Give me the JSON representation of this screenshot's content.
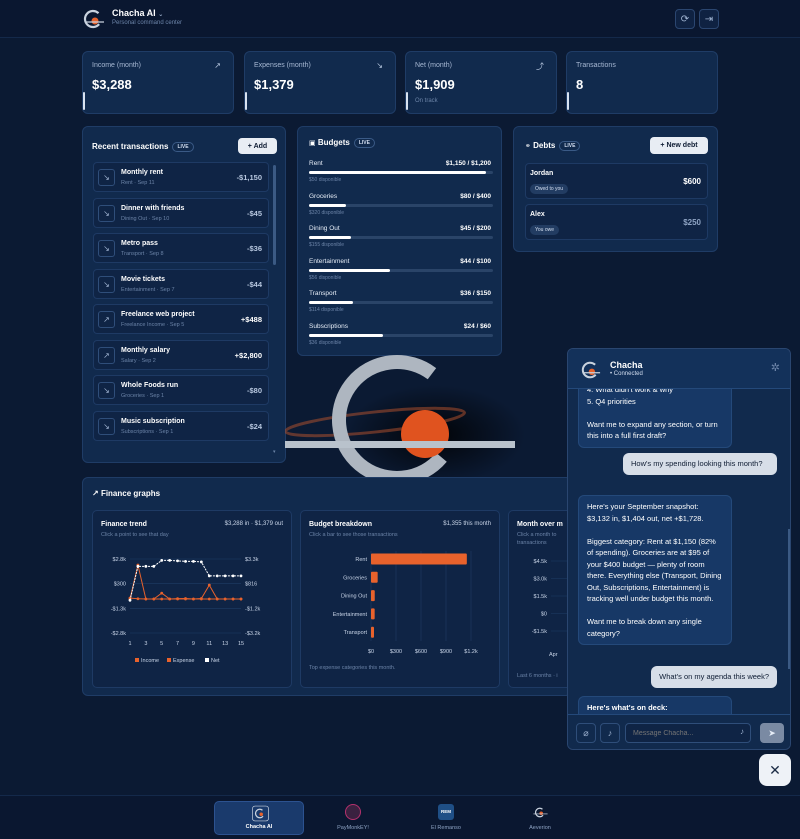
{
  "header": {
    "title": "Chacha AI",
    "subtitle": "Personal command center"
  },
  "stats": [
    {
      "label": "Income (month)",
      "value": "$3,288",
      "sub": "",
      "icon": "arrow-up-right-icon"
    },
    {
      "label": "Expenses (month)",
      "value": "$1,379",
      "sub": "",
      "icon": "arrow-down-right-icon"
    },
    {
      "label": "Net (month)",
      "value": "$1,909",
      "sub": "On track",
      "icon": "trend-up-icon"
    },
    {
      "label": "Transactions",
      "value": "8",
      "sub": "",
      "icon": ""
    }
  ],
  "transactions": {
    "title": "Recent transactions",
    "live": "LIVE",
    "add_label": "+ Add",
    "items": [
      {
        "name": "Monthly rent",
        "sub": "Rent · Sep 11",
        "amount": "-$1,150",
        "dir": "out"
      },
      {
        "name": "Dinner with friends",
        "sub": "Dining Out · Sep 10",
        "amount": "-$45",
        "dir": "out"
      },
      {
        "name": "Metro pass",
        "sub": "Transport · Sep 8",
        "amount": "-$36",
        "dir": "out"
      },
      {
        "name": "Movie tickets",
        "sub": "Entertainment · Sep 7",
        "amount": "-$44",
        "dir": "out"
      },
      {
        "name": "Freelance web project",
        "sub": "Freelance Income · Sep 5",
        "amount": "+$488",
        "dir": "in"
      },
      {
        "name": "Monthly salary",
        "sub": "Salary · Sep 2",
        "amount": "+$2,800",
        "dir": "in"
      },
      {
        "name": "Whole Foods run",
        "sub": "Groceries · Sep 1",
        "amount": "-$80",
        "dir": "out"
      },
      {
        "name": "Music subscription",
        "sub": "Subscriptions · Sep 1",
        "amount": "-$24",
        "dir": "out"
      }
    ]
  },
  "budgets": {
    "title": "Budgets",
    "live": "LIVE",
    "items": [
      {
        "name": "Rent",
        "value": "$1,150 / $1,200",
        "sub": "$50 disponible",
        "fill": 0.96
      },
      {
        "name": "Groceries",
        "value": "$80 / $400",
        "sub": "$320 disponible",
        "fill": 0.2
      },
      {
        "name": "Dining Out",
        "value": "$45 / $200",
        "sub": "$155 disponible",
        "fill": 0.23
      },
      {
        "name": "Entertainment",
        "value": "$44 / $100",
        "sub": "$56 disponible",
        "fill": 0.44
      },
      {
        "name": "Transport",
        "value": "$36 / $150",
        "sub": "$114 disponible",
        "fill": 0.24
      },
      {
        "name": "Subscriptions",
        "value": "$24 / $60",
        "sub": "$36 disponible",
        "fill": 0.4
      }
    ]
  },
  "debts": {
    "title": "Debts",
    "live": "LIVE",
    "new_label": "+ New debt",
    "items": [
      {
        "name": "Jordan",
        "tag": "Owed to you",
        "amount": "$600"
      },
      {
        "name": "Alex",
        "tag": "You owe",
        "amount": "$250"
      }
    ]
  },
  "graphs": {
    "title": "Finance graphs",
    "trend": {
      "title": "Finance trend",
      "range": "$3,288 in · $1,379 out",
      "sub": "Click a point to see that day"
    },
    "breakdown": {
      "title": "Budget breakdown",
      "range": "$1,355 this month",
      "sub": "Click a bar to see those transactions",
      "footer": "Top expense categories this month."
    },
    "monthly": {
      "title": "Month over m",
      "sub": "Click a month to",
      "sub2": "transactions",
      "footer": "Last 6 months · i"
    }
  },
  "chart_data": [
    {
      "type": "line",
      "title": "Finance trend",
      "x": [
        1,
        2,
        3,
        4,
        5,
        6,
        7,
        8,
        9,
        10,
        11,
        12,
        13,
        14,
        15
      ],
      "x_ticks": [
        "1",
        "3",
        "5",
        "7",
        "9",
        "11",
        "13",
        "15"
      ],
      "y_left_ticks": [
        "$2.8k",
        "$300",
        "-$1.3k",
        "-$2.8k"
      ],
      "y_right_ticks": [
        "$3.3k",
        "$816",
        "-$1.2k",
        "-$3.2k"
      ],
      "series": [
        {
          "name": "Income",
          "values": [
            0,
            2800,
            0,
            0,
            488,
            0,
            0,
            0,
            0,
            0,
            0,
            0,
            0,
            0,
            0
          ]
        },
        {
          "name": "Expense",
          "values": [
            80,
            24,
            0,
            0,
            0,
            0,
            36,
            44,
            0,
            45,
            1150,
            0,
            0,
            0,
            0
          ]
        },
        {
          "name": "Net",
          "values": [
            -104,
            2696,
            2696,
            2696,
            3184,
            3184,
            3148,
            3104,
            3104,
            3059,
            1909,
            1909,
            1909,
            1909,
            1909
          ]
        }
      ]
    },
    {
      "type": "bar",
      "title": "Budget breakdown",
      "categories": [
        "Rent",
        "Groceries",
        "Dining Out",
        "Entertainment",
        "Transport"
      ],
      "values": [
        1150,
        80,
        45,
        44,
        36
      ],
      "x_ticks": [
        "$0",
        "$300",
        "$600",
        "$900",
        "$1.2k"
      ],
      "xlim": [
        0,
        1200
      ]
    },
    {
      "type": "bar",
      "title": "Month over m",
      "y_ticks": [
        "$4.5k",
        "$3.0k",
        "$1.5k",
        "$0",
        "-$1.5k"
      ],
      "categories": [
        "Apr"
      ]
    }
  ],
  "chat": {
    "name": "Chacha",
    "status": "• Connected",
    "messages": [
      {
        "role": "bot",
        "text": "4. What didn't work & why\n5. Q4 priorities\n\nWant me to expand any section, or turn this into a full first draft?"
      },
      {
        "role": "me",
        "text": "How's my spending looking this month?"
      },
      {
        "role": "bot",
        "text": "Here's your September snapshot: $3,132 in, $1,404 out, net +$1,728.\n\nBiggest category: Rent at $1,150 (82% of spending). Groceries are at $95 of your $400 budget — plenty of room there. Everything else (Transport, Dining Out, Subscriptions, Entertainment) is tracking well under budget this month.\n\nWant me to break down any single category?"
      },
      {
        "role": "me",
        "text": "What's on my agenda this week?"
      },
      {
        "role": "bot",
        "text": "Here's what's on deck:"
      }
    ],
    "placeholder": "Message Chacha..."
  },
  "nav": [
    {
      "label": "Chacha AI",
      "active": true
    },
    {
      "label": "PayMonkEY!",
      "active": false
    },
    {
      "label": "El Remanso",
      "active": false
    },
    {
      "label": "Aeverion",
      "active": false
    }
  ],
  "colors": {
    "accent": "#e8622c",
    "bg": "#0b1a33",
    "panel": "#112a4d"
  }
}
